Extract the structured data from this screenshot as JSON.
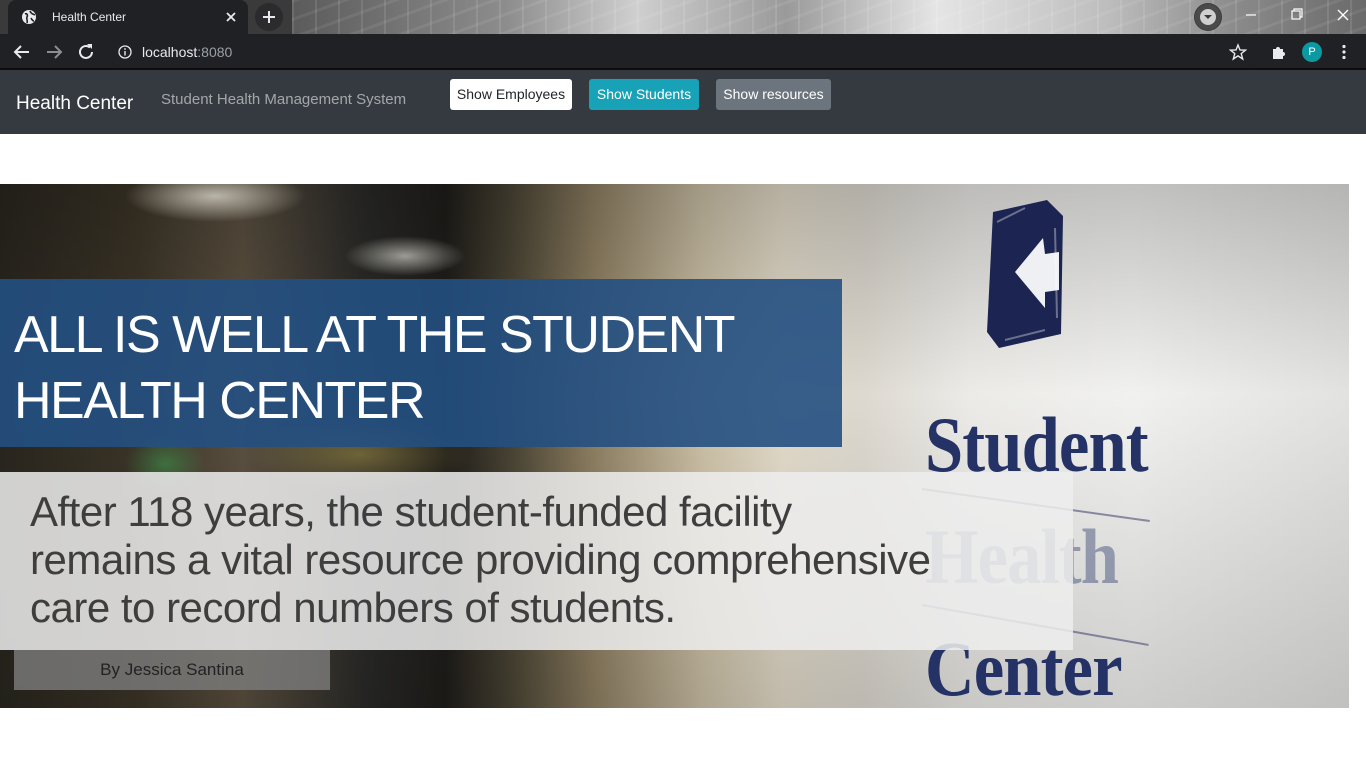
{
  "browser": {
    "tab_title": "Health Center",
    "url_host": "localhost",
    "url_port": ":8080",
    "profile_initial": "P"
  },
  "navbar": {
    "brand": "Health Center",
    "subtitle": "Student Health Management System",
    "buttons": [
      {
        "label": "Show Employees",
        "color": "#ffffff"
      },
      {
        "label": "Show Students",
        "color": "#17a2b8"
      },
      {
        "label": "Show resources",
        "color": "#6c757d"
      }
    ]
  },
  "hero": {
    "headline_line1": "ALL IS WELL AT THE STUDENT",
    "headline_line2": "HEALTH CENTER",
    "subhead_line1": "After 118 years, the student-funded facility",
    "subhead_line2": "remains a vital resource providing comprehensive",
    "subhead_line3": "care to record numbers of students.",
    "byline": "By Jessica Santina",
    "wall_sign_lines": [
      "Student",
      "Health",
      "Center"
    ]
  },
  "colors": {
    "navbar_bg": "#343a40",
    "headline_band": "#235082",
    "chrome_bg": "#202124"
  }
}
